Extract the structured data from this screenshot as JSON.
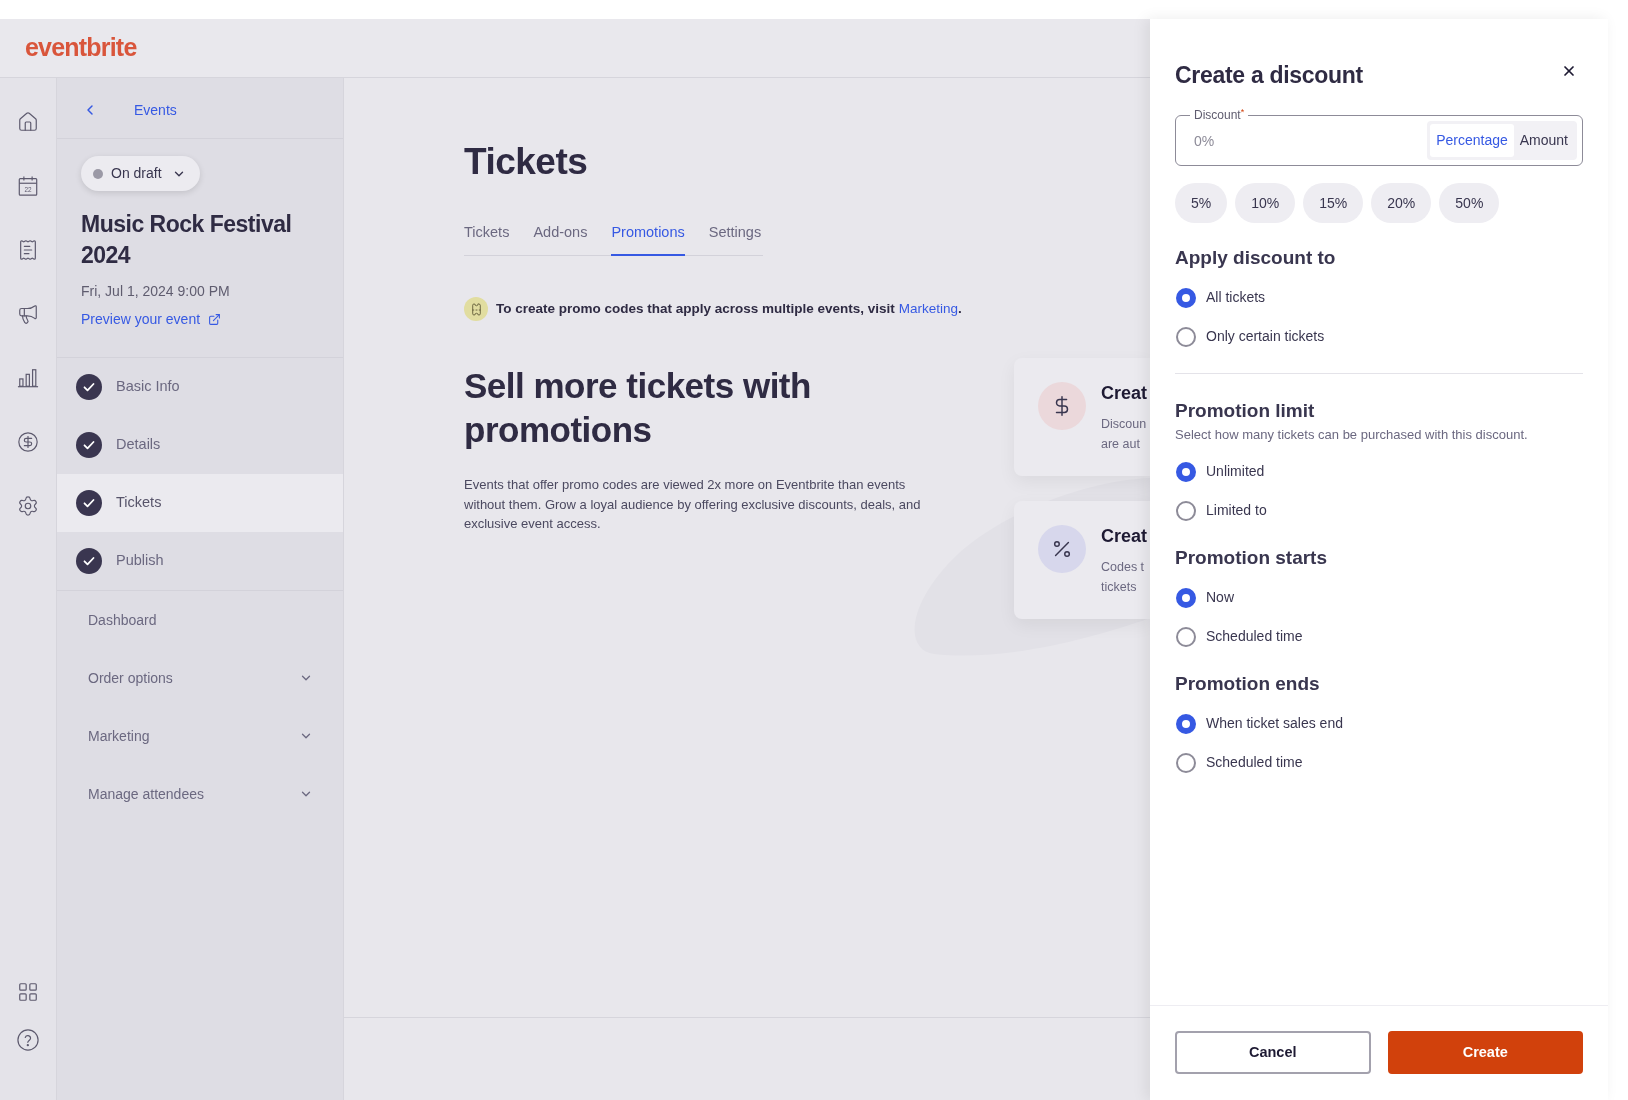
{
  "header": {
    "logo": "eventbrite"
  },
  "rail": {
    "calendar_day": "22"
  },
  "sidebar": {
    "back_link": "Events",
    "status": {
      "label": "On draft"
    },
    "event": {
      "title": "Music Rock Festival 2024",
      "date": "Fri, Jul 1, 2024 9:00 PM",
      "preview_link": "Preview your event"
    },
    "steps": [
      {
        "label": "Basic Info",
        "done": true,
        "selected": false
      },
      {
        "label": "Details",
        "done": true,
        "selected": false
      },
      {
        "label": "Tickets",
        "done": true,
        "selected": true
      },
      {
        "label": "Publish",
        "done": true,
        "selected": false
      }
    ],
    "menu": [
      {
        "label": "Dashboard",
        "kind": "link"
      },
      {
        "label": "Order options",
        "kind": "group",
        "expanded": false
      },
      {
        "label": "Marketing",
        "kind": "group",
        "expanded": false
      },
      {
        "label": "Manage attendees",
        "kind": "group",
        "expanded": false
      }
    ]
  },
  "main": {
    "title": "Tickets",
    "tabs": [
      {
        "label": "Tickets",
        "selected": false
      },
      {
        "label": "Add-ons",
        "selected": false
      },
      {
        "label": "Promotions",
        "selected": true
      },
      {
        "label": "Settings",
        "selected": false
      }
    ],
    "notice": {
      "text": "To create promo codes that apply across multiple events, visit",
      "link": "Marketing",
      "end": "."
    },
    "heading": "Sell more tickets with promotions",
    "description": "Events that offer promo codes are viewed 2x more on Eventbrite than events without them. Grow a loyal audience by offering exclusive discounts, deals, and exclusive event access.",
    "cards": [
      {
        "kind": "dollar",
        "color": "#ebd8db",
        "title": "Creat",
        "lines": [
          "Discoun",
          "are aut"
        ]
      },
      {
        "kind": "percent",
        "color": "#d7d7ec",
        "title": "Creat",
        "lines": [
          "Codes t",
          "tickets"
        ]
      }
    ]
  },
  "panel": {
    "title": "Create a discount",
    "discount": {
      "label": "Discount$^{*}$",
      "placeholder": "0%",
      "units": [
        {
          "label": "Percentage",
          "selected": true
        },
        {
          "label": "Amount",
          "selected": false
        }
      ]
    },
    "presets": [
      "5%",
      "10%",
      "15%",
      "20%",
      "50%"
    ],
    "sections": [
      {
        "title": "Apply discount to",
        "options": [
          {
            "label": "All tickets",
            "selected": true
          },
          {
            "label": "Only certain tickets",
            "selected": false
          }
        ],
        "divider_after": true
      },
      {
        "title": "Promotion limit",
        "hint": "Select how many tickets can be purchased with this discount.",
        "options": [
          {
            "label": "Unlimited",
            "selected": true
          },
          {
            "label": "Limited to",
            "selected": false
          }
        ],
        "divider_after": false
      },
      {
        "title": "Promotion starts",
        "options": [
          {
            "label": "Now",
            "selected": true
          },
          {
            "label": "Scheduled time",
            "selected": false
          }
        ],
        "divider_after": false
      },
      {
        "title": "Promotion ends",
        "options": [
          {
            "label": "When ticket sales end",
            "selected": true
          },
          {
            "label": "Scheduled time",
            "selected": false
          }
        ],
        "divider_after": false
      }
    ],
    "actions": [
      {
        "label": "Cancel",
        "kind": "secondary"
      },
      {
        "label": "Create",
        "kind": "primary"
      }
    ]
  }
}
